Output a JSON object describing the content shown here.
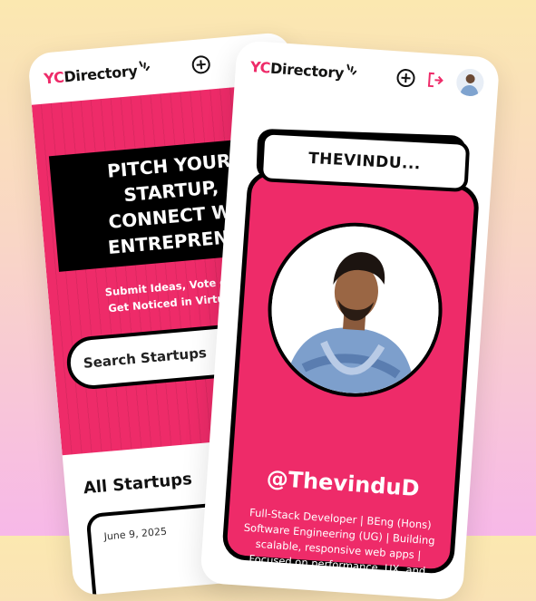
{
  "colors": {
    "accent": "#ee2b69",
    "dark": "#141413",
    "white": "#ffffff"
  },
  "brand": {
    "yc": "YC",
    "name": "Directory"
  },
  "home_screen": {
    "hero_lines": [
      "PITCH YOUR",
      "STARTUP,",
      "CONNECT WI",
      "ENTREPRENU"
    ],
    "hero_subtitle_lines": [
      "Submit Ideas, Vote on Pit",
      "Get Noticed in Virtual Co"
    ],
    "search_placeholder": "Search Startups",
    "section_title": "All Startups",
    "first_card_date": "June 9, 2025"
  },
  "profile_screen": {
    "name": "THEVINDU...",
    "handle": "@ThevinduD",
    "bio": "Full-Stack Developer | BEng (Hons) Software Engineering (UG) | Building scalable, responsive web apps | Focused on performance, UX, and clean code",
    "icons": [
      "add-icon",
      "logout-icon",
      "avatar"
    ]
  }
}
